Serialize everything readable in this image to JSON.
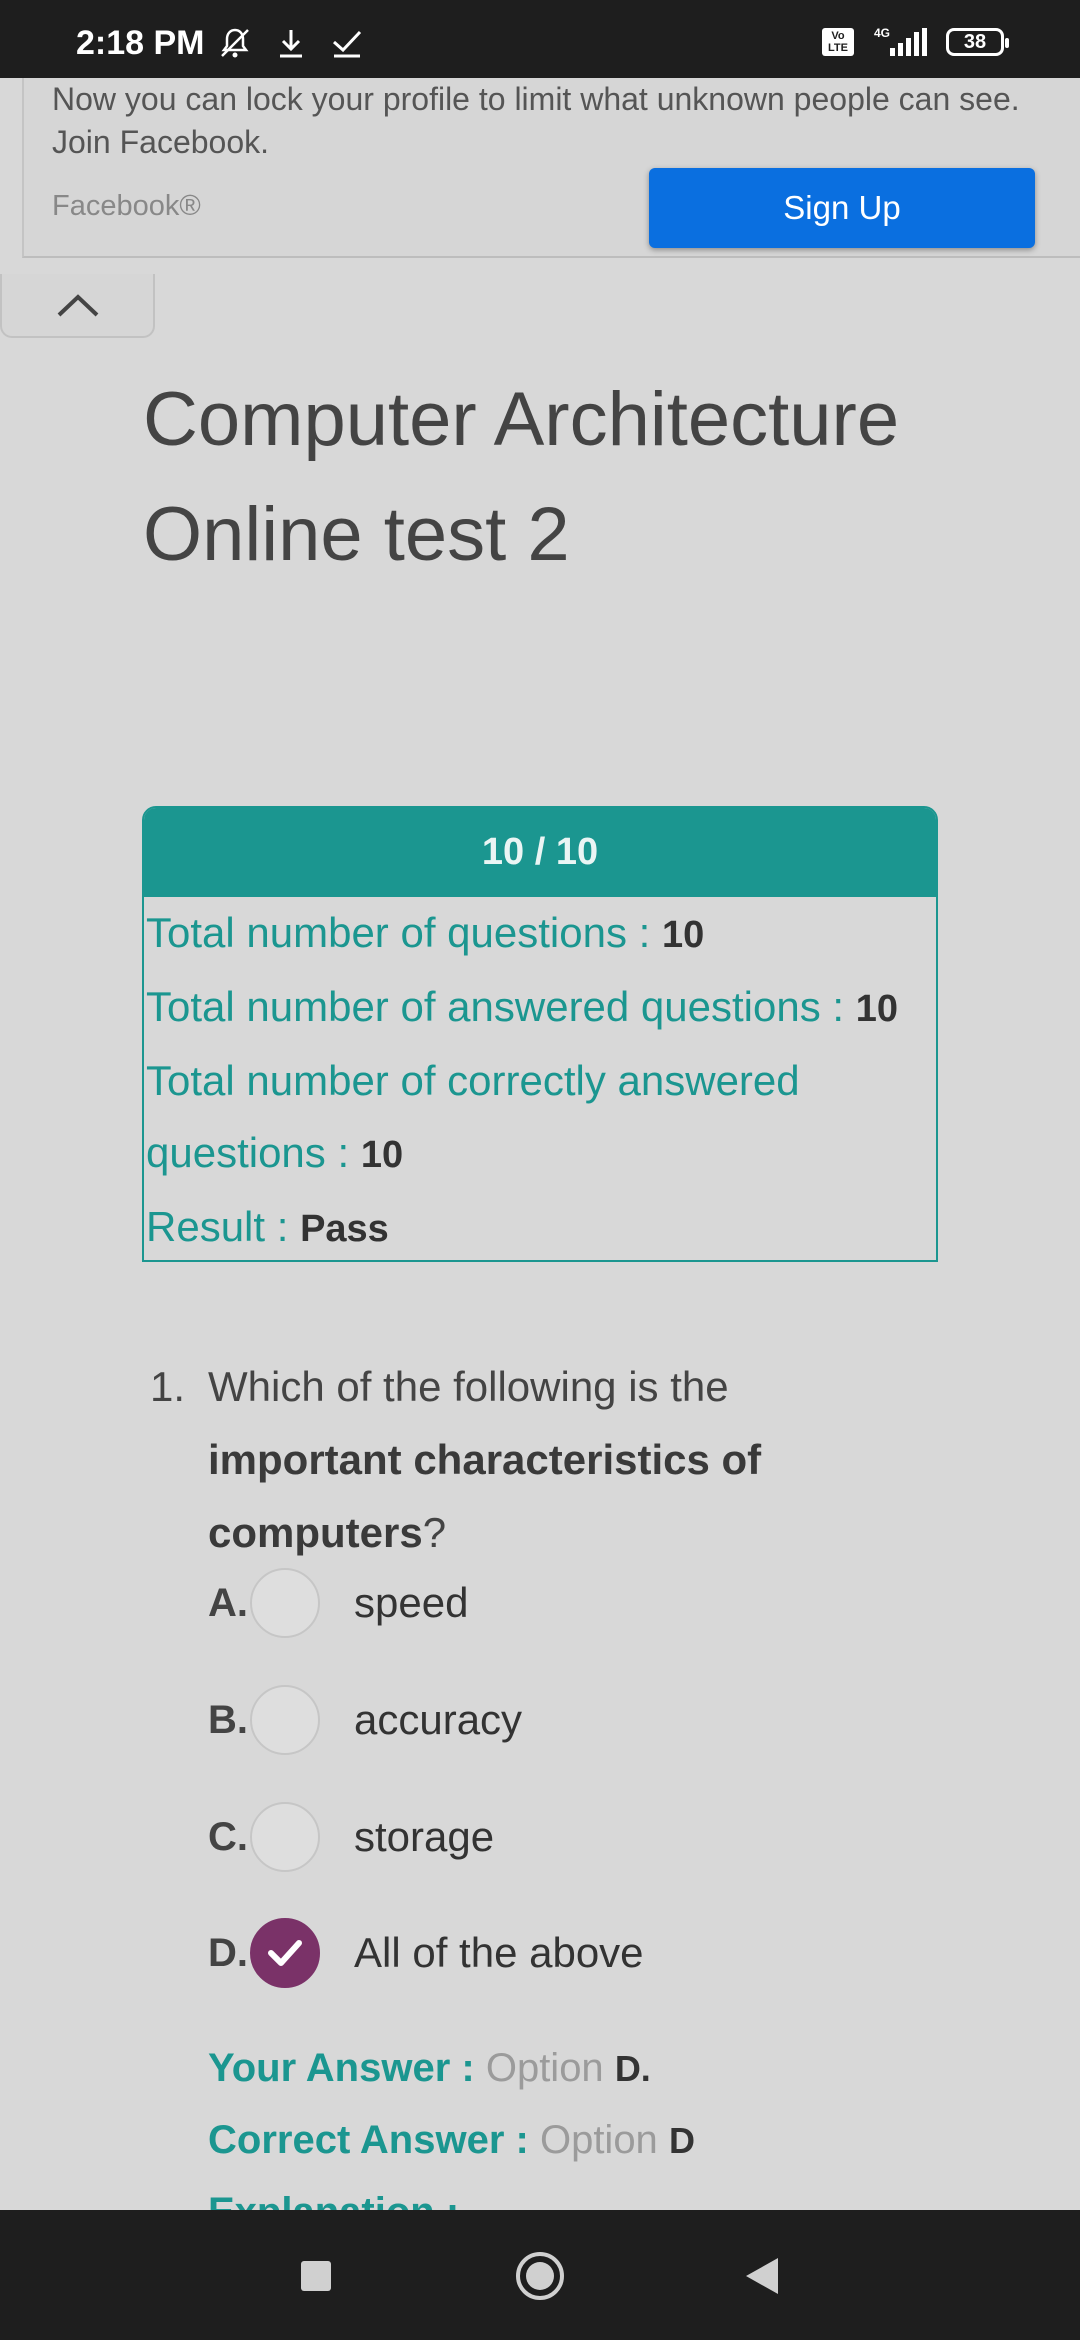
{
  "status_bar": {
    "time": "2:18 PM",
    "battery": "38",
    "network": "4G",
    "volte": "Vo LTE"
  },
  "ad": {
    "text": "Now you can lock your profile to limit what unknown people can see. Join Facebook.",
    "brand": "Facebook®",
    "cta": "Sign Up"
  },
  "page": {
    "title": "Computer Architecture Online test 2"
  },
  "score": {
    "header": "10 / 10",
    "rows": [
      {
        "label": "Total number of questions : ",
        "value": "10"
      },
      {
        "label": "Total number of answered questions : ",
        "value": "10"
      },
      {
        "label": "Total number of correctly answered questions : ",
        "value": "10"
      },
      {
        "label": "Result : ",
        "value": "Pass"
      }
    ]
  },
  "question": {
    "number": "1.",
    "text_before": "Which of the following is the ",
    "text_bold": "important characteristics of computers",
    "text_after": "?",
    "options": [
      {
        "letter": "A.",
        "text": "speed",
        "selected": false
      },
      {
        "letter": "B.",
        "text": "accuracy",
        "selected": false
      },
      {
        "letter": "C.",
        "text": "storage",
        "selected": false
      },
      {
        "letter": "D.",
        "text": "All of the above",
        "selected": true
      }
    ],
    "your_answer_label": "Your Answer :",
    "your_answer_word": "Option",
    "your_answer_value": "D.",
    "correct_answer_label": "Correct Answer :",
    "correct_answer_word": "Option",
    "correct_answer_value": "D",
    "explanation_label": "Explanation :"
  },
  "colors": {
    "accent": "#1b9690",
    "selected": "#7a3268",
    "facebook_blue": "#0a6fe0"
  }
}
